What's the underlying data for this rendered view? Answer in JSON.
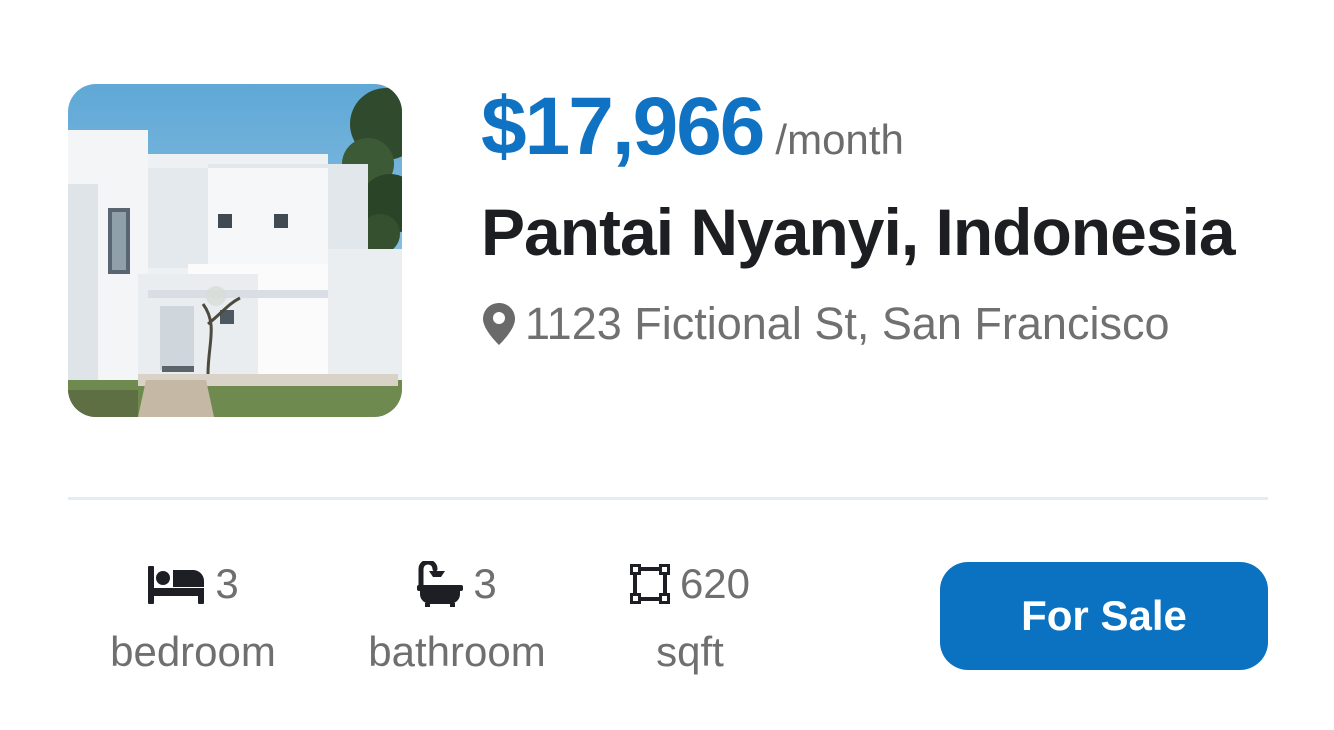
{
  "listing": {
    "price": "$17,966",
    "price_period": "/month",
    "title": "Pantai Nyanyi, Indonesia",
    "address": "1123 Fictional St, San Francisco",
    "photo_icon": "house-photo"
  },
  "stats": [
    {
      "icon": "bed-icon",
      "value": "3",
      "label": "bedroom"
    },
    {
      "icon": "bathtub-icon",
      "value": "3",
      "label": "bathroom"
    },
    {
      "icon": "area-icon",
      "value": "620",
      "label": "sqft"
    }
  ],
  "cta": {
    "label": "For Sale"
  },
  "colors": {
    "accent": "#0f72c2",
    "button": "#0b72c1",
    "title": "#1d1e22",
    "muted": "#707070",
    "divider": "#e6edf2"
  }
}
